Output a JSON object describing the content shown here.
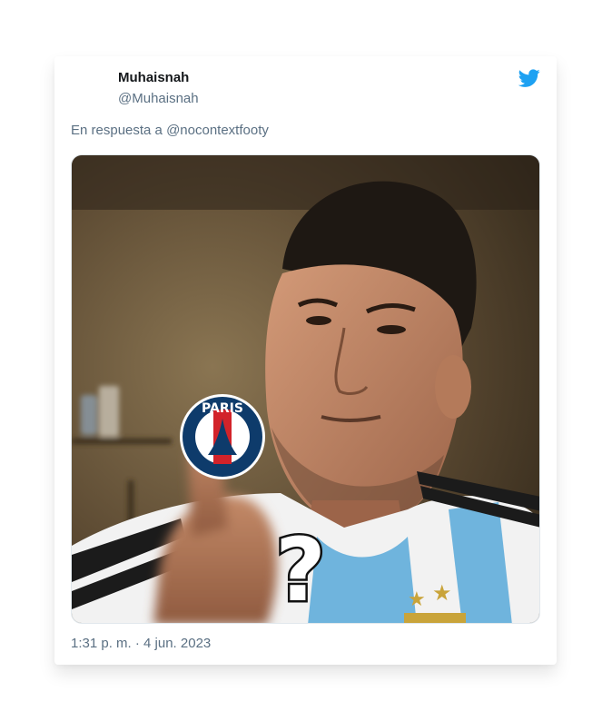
{
  "tweet": {
    "display_name": "Muhaisnah",
    "handle": "@Muhaisnah",
    "reply_prefix": "En respuesta a",
    "reply_to": "@nocontextfooty",
    "timestamp": "1:31 p. m. · 4 jun. 2023",
    "brand_color": "#1da1f2",
    "icons": [
      "twitter-bird-icon"
    ],
    "media": {
      "description_icon": "meme-photo",
      "badge_text": "PARIS",
      "overlay_glyph": "?"
    }
  }
}
